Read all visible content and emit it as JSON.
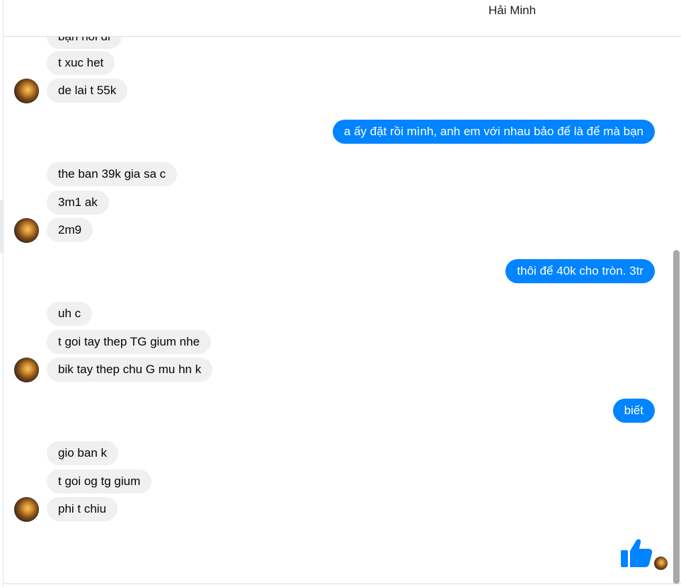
{
  "header": {
    "contact_name": "Hải Minh"
  },
  "messages": {
    "g1": [
      "bạn nói đi",
      "t xuc het",
      "de lai t 55k"
    ],
    "o1": "a ấy đặt rồi mình, anh em với nhau bảo để là để mà bạn",
    "g2": [
      "the ban 39k gia sa c",
      "3m1 ak",
      "2m9"
    ],
    "o2": "thôi để 40k cho tròn. 3tr",
    "g3": [
      "uh c",
      "t goi tay thep TG gium nhe",
      "bik tay thep chu G mu hn k"
    ],
    "o3": "biết",
    "g4": [
      "gio ban k",
      "t goi og tg gium",
      "phi t chiu"
    ]
  },
  "colors": {
    "outgoing": "#0084ff",
    "incoming": "#f0f0f0",
    "like": "#0084ff"
  },
  "icons": {
    "like": "thumbs-up-icon",
    "avatar": "contact-avatar"
  }
}
